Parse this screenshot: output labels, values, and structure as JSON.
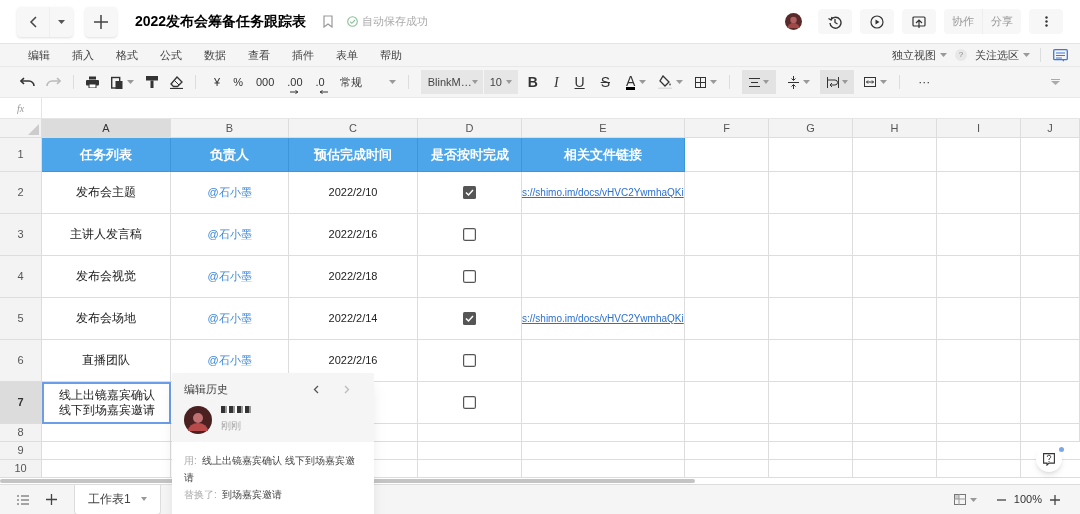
{
  "document": {
    "title": "2022发布会筹备任务跟踪表",
    "save_status": "自动保存成功"
  },
  "top_buttons": [
    {
      "label": "协作"
    },
    {
      "label": "分享"
    }
  ],
  "menu": [
    "编辑",
    "插入",
    "格式",
    "公式",
    "数据",
    "查看",
    "插件",
    "表单",
    "帮助"
  ],
  "view_options": {
    "view": "独立视图",
    "help": "?",
    "focus": "关注选区"
  },
  "toolbar": {
    "number_formats": [
      "¥",
      "%",
      "000",
      ".00",
      ".0"
    ],
    "format": "常规",
    "font": "BlinkM…",
    "font_size": "10",
    "text_styles": [
      "B",
      "I",
      "U",
      "S",
      "A"
    ],
    "more": "···"
  },
  "formula_bar": {
    "label": "fx"
  },
  "columns": [
    {
      "letter": "A",
      "selected": true
    },
    {
      "letter": "B",
      "selected": false
    },
    {
      "letter": "C",
      "selected": false
    },
    {
      "letter": "D",
      "selected": false
    },
    {
      "letter": "E",
      "selected": false
    },
    {
      "letter": "F",
      "selected": false
    },
    {
      "letter": "G",
      "selected": false
    },
    {
      "letter": "H",
      "selected": false
    },
    {
      "letter": "I",
      "selected": false
    },
    {
      "letter": "J",
      "selected": false
    }
  ],
  "rows": [
    {
      "number": "1",
      "selected": false,
      "kind": "header",
      "cells": [
        "任务列表",
        "负责人",
        "预估完成时间",
        "是否按时完成",
        "相关文件链接"
      ]
    },
    {
      "number": "2",
      "selected": false,
      "kind": "task",
      "active": false,
      "task": "发布会主题",
      "owner": "@石小墨",
      "date": "2022/2/10",
      "done": true,
      "link": "s://shimo.im/docs/vHVC2YwmhaQKi"
    },
    {
      "number": "3",
      "selected": false,
      "kind": "task",
      "active": false,
      "task": "主讲人发言稿",
      "owner": "@石小墨",
      "date": "2022/2/16",
      "done": false
    },
    {
      "number": "4",
      "selected": false,
      "kind": "task",
      "active": false,
      "task": "发布会视觉",
      "owner": "@石小墨",
      "date": "2022/2/18",
      "done": false
    },
    {
      "number": "5",
      "selected": false,
      "kind": "task",
      "active": false,
      "task": "发布会场地",
      "owner": "@石小墨",
      "date": "2022/2/14",
      "done": true,
      "link": "s://shimo.im/docs/vHVC2YwmhaQKi"
    },
    {
      "number": "6",
      "selected": false,
      "kind": "task",
      "active": false,
      "task": "直播团队",
      "owner": "@石小墨",
      "date": "2022/2/16",
      "done": false
    },
    {
      "number": "7",
      "selected": true,
      "kind": "task",
      "active": true,
      "task": "线上出镜嘉宾确认线下到场嘉宾邀请",
      "done": false
    },
    {
      "number": "8",
      "selected": false,
      "kind": "empty"
    },
    {
      "number": "9",
      "selected": false,
      "kind": "empty"
    },
    {
      "number": "10",
      "selected": false,
      "kind": "empty"
    }
  ],
  "edit_history": {
    "title": "编辑历史",
    "time": "刚刚",
    "used_label": "用:",
    "used_text": "线上出镜嘉宾确认 线下到场嘉宾邀请",
    "replaced_label": "替换了:",
    "replaced_text": "到场嘉宾邀请"
  },
  "sheets": [
    {
      "name": "工作表1",
      "selected": true
    }
  ],
  "zoom": "100%"
}
